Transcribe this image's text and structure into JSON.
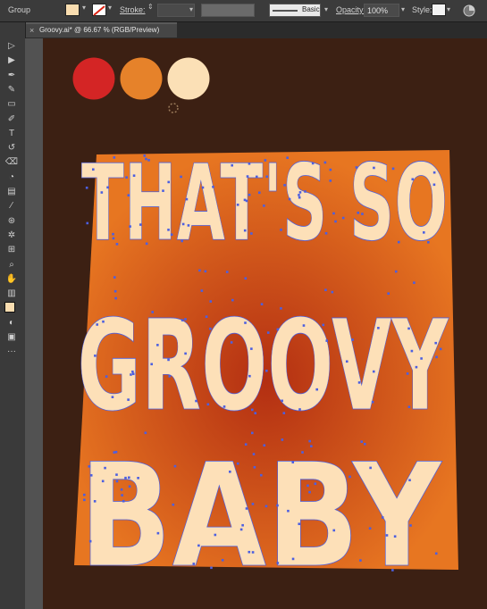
{
  "control_bar": {
    "selection_label": "Group",
    "fill_color": "#f9ddb0",
    "stroke_label": "Stroke:",
    "stroke_style_label": "Basic",
    "opacity_label": "Opacity:",
    "opacity_value": "100%",
    "style_label": "Style:"
  },
  "document_tab": {
    "close_glyph": "×",
    "title": "Groovy.ai* @ 66.67 % (RGB/Preview)"
  },
  "tools": [
    "selection-tool",
    "direct-selection-tool",
    "pen-tool",
    "curvature-tool",
    "rectangle-tool",
    "paintbrush-tool",
    "type-tool",
    "rotate-tool",
    "eraser-tool",
    "shape-builder-tool",
    "gradient-tool",
    "eyedropper-tool",
    "blend-tool",
    "symbol-sprayer-tool",
    "artboard-tool",
    "zoom-tool",
    "hand-tool",
    "column-graph-tool",
    "fill-stroke-swatches",
    "draw-mode",
    "screen-mode",
    "more-tools"
  ],
  "palette": {
    "colors": [
      "#d42525",
      "#e6822a",
      "#fbe0b6"
    ]
  },
  "artwork": {
    "lines": [
      "THAT'S SO",
      "GROOVY",
      "BABY"
    ],
    "text_color": "#fde0b8",
    "shadow_color_dark": "#b92f12",
    "shadow_color_light": "#f07a22",
    "background": "#3c2013",
    "anchor_color": "#4c5fe0"
  }
}
